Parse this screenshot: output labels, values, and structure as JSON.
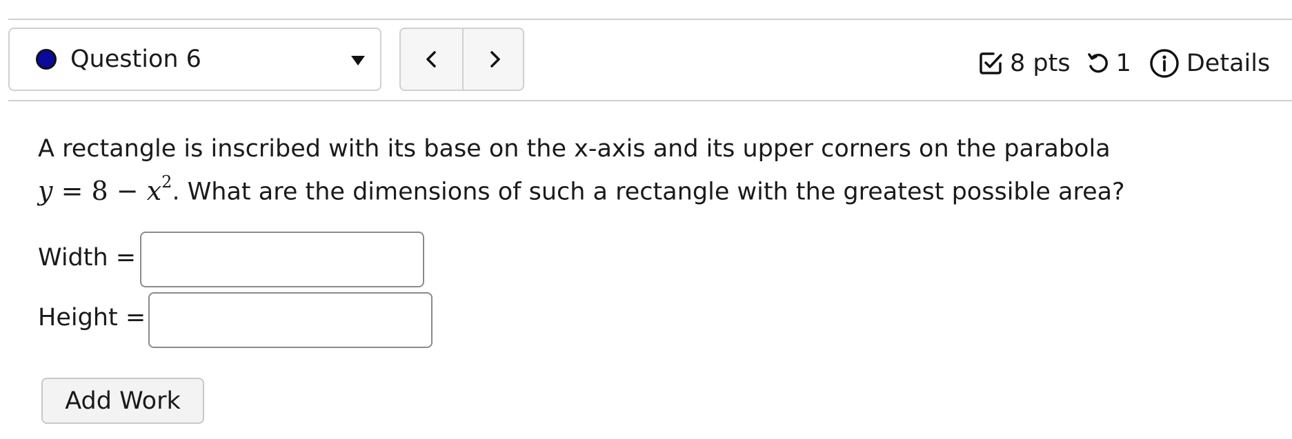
{
  "question_nav": {
    "current_label": "Question 6",
    "status_color": "#0a0a9e",
    "dropdown_icon": "caret-down-icon",
    "prev_icon": "chevron-left-icon",
    "next_icon": "chevron-right-icon"
  },
  "meta": {
    "points_icon": "checkbox-icon",
    "points": "8 pts",
    "attempts_icon": "retry-icon",
    "attempts": "1",
    "details_icon": "info-icon",
    "details_label": "Details"
  },
  "question": {
    "text_line1": "A rectangle is inscribed with its base on the x-axis and its upper corners on the parabola",
    "equation": {
      "lhs": "y",
      "equals": "=",
      "constant": "8",
      "minus": "−",
      "variable": "x",
      "exponent": "2"
    },
    "text_line2": ". What are the dimensions of such a rectangle with the greatest possible area?"
  },
  "answers": {
    "width_label": "Width =",
    "width_value": "",
    "height_label": "Height =",
    "height_value": ""
  },
  "actions": {
    "add_work_label": "Add Work"
  }
}
